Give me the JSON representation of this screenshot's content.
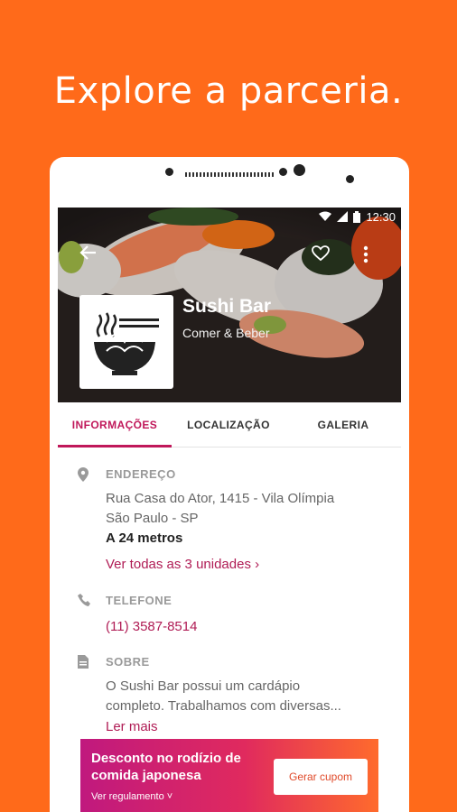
{
  "headline": "Explore a parceria.",
  "status": {
    "time": "12:30"
  },
  "business": {
    "name": "Sushi Bar",
    "category": "Comer & Beber"
  },
  "tabs": [
    {
      "label": "INFORMAÇÕES",
      "active": true
    },
    {
      "label": "LOCALIZAÇÃO",
      "active": false
    },
    {
      "label": "GALERIA",
      "active": false
    }
  ],
  "address": {
    "title": "ENDEREÇO",
    "line1": "Rua Casa do Ator, 1415 - Vila Olímpia",
    "line2": "São Paulo - SP",
    "distance": "A 24 metros",
    "units_link": "Ver todas as 3 unidades ›"
  },
  "phone": {
    "title": "TELEFONE",
    "number": "(11) 3587-8514"
  },
  "about": {
    "title": "SOBRE",
    "line1": "O Sushi Bar possui um cardápio",
    "line2": "completo. Trabalhamos com diversas...",
    "more_link": "Ler mais"
  },
  "promo": {
    "title": "Desconto no rodízio de comida japonesa",
    "rules_link": "Ver regulamento ˅",
    "button_label": "Gerar cupom"
  },
  "colors": {
    "background": "#ff6a1a",
    "accent": "#c0185a",
    "link": "#b01c55",
    "banner_start": "#c0197e",
    "banner_end": "#ff6b2c"
  },
  "icons": [
    "back-arrow-icon",
    "heart-icon",
    "more-vert-icon",
    "location-pin-icon",
    "phone-icon",
    "document-icon",
    "noodle-bowl-icon",
    "wifi-icon",
    "signal-icon",
    "battery-icon"
  ]
}
